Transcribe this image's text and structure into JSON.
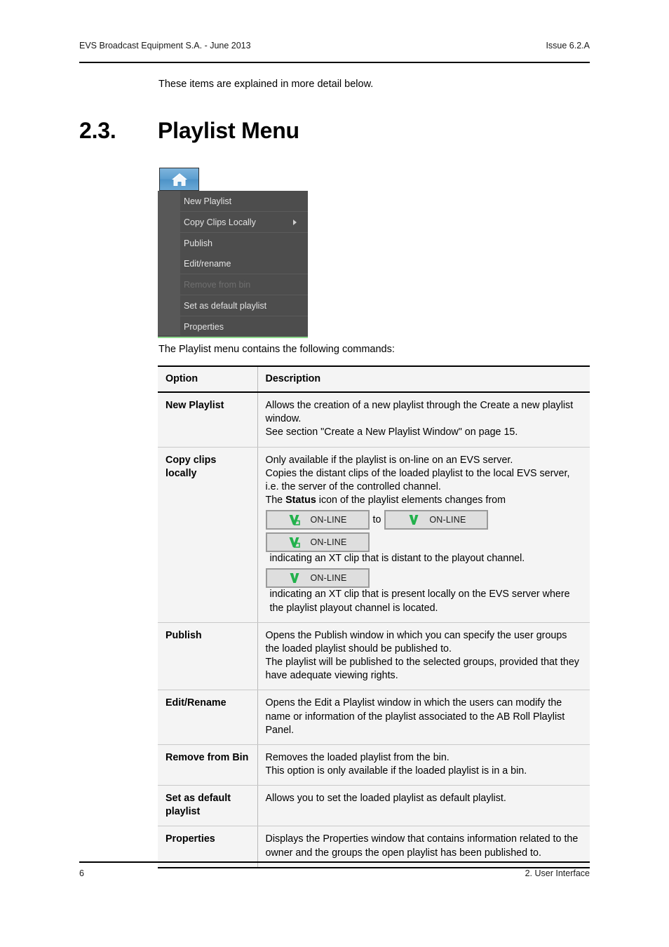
{
  "header": {
    "left": "EVS Broadcast Equipment S.A.  - June 2013",
    "right": "Issue 6.2.A"
  },
  "intro_text": "These items are explained in more detail below.",
  "section": {
    "number": "2.3.",
    "title": "Playlist Menu"
  },
  "screenshot": {
    "home_button_icon": "home-icon",
    "menu_items": [
      {
        "label": "New Playlist",
        "disabled": false,
        "submenu": false
      },
      {
        "label": "Copy Clips Locally",
        "disabled": false,
        "submenu": true
      },
      {
        "label": "Publish",
        "disabled": false,
        "submenu": false
      },
      {
        "label": "Edit/rename",
        "disabled": false,
        "submenu": false
      },
      {
        "label": "Remove from bin",
        "disabled": true,
        "submenu": false
      },
      {
        "label": "Set as default playlist",
        "disabled": false,
        "submenu": false
      },
      {
        "label": "Properties",
        "disabled": false,
        "submenu": false
      }
    ],
    "accent_color": "#8ed98e",
    "menu_background": "#4d4d4d",
    "button_color": "#5d9fd0"
  },
  "lead_text": "The Playlist menu contains the following commands:",
  "table": {
    "headers": {
      "option": "Option",
      "description": "Description"
    },
    "rows": {
      "new_playlist": {
        "option": "New Playlist",
        "line1": "Allows the creation of a new playlist through the Create a new playlist window.",
        "line2": "See section \"Create a New Playlist Window\" on page 15."
      },
      "copy_clips": {
        "option": "Copy clips locally",
        "line1": "Only available if the playlist is on-line on an EVS server.",
        "line2": "Copies the distant clips of the loaded playlist to the local EVS server, i.e. the server of the controlled channel.",
        "line3_pre": "The ",
        "line3_bold": "Status",
        "line3_post": " icon of the playlist elements changes from",
        "badge_distant_label": "ON-LINE",
        "badge_local_label": "ON-LINE",
        "to_word": "to",
        "distant_desc": "indicating an XT clip that is distant to the playout channel.",
        "local_desc": "indicating an XT clip that is present locally on the EVS server where the playlist playout channel is located.",
        "badge_icon_color": "#22b14c"
      },
      "publish": {
        "option": "Publish",
        "line1": "Opens the Publish window in which you can specify the user groups the loaded playlist should be published to.",
        "line2": "The playlist will be published to the selected groups, provided that they have adequate viewing rights."
      },
      "edit_rename": {
        "option": "Edit/Rename",
        "line1": "Opens the Edit a Playlist window in which the users can modify the name or information of the playlist associated to the AB Roll Playlist Panel."
      },
      "remove_from_bin": {
        "option": "Remove from Bin",
        "line1": "Removes the loaded playlist from the bin.",
        "line2": "This option is only available if the loaded playlist is in a bin."
      },
      "set_default": {
        "option": "Set as default playlist",
        "line1": "Allows you to set the loaded playlist as default playlist."
      },
      "properties": {
        "option": "Properties",
        "line1": "Displays the Properties window that contains information related to the owner and the groups the open playlist has been published to."
      }
    }
  },
  "footer": {
    "page_number": "6",
    "chapter": "2. User Interface"
  }
}
